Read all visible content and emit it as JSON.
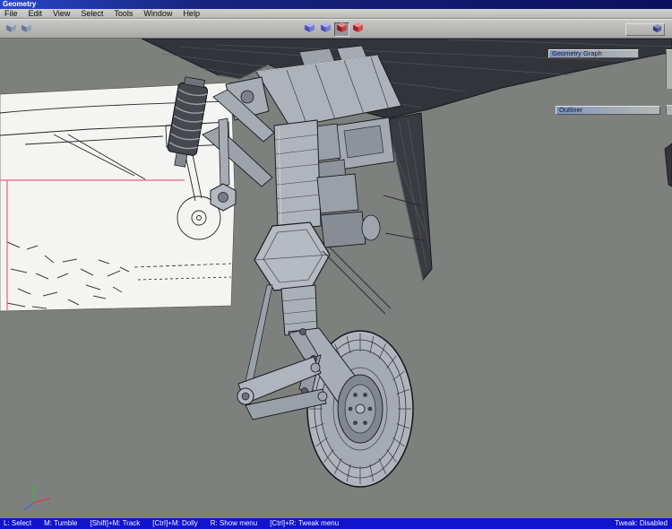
{
  "window": {
    "title": "Geometry"
  },
  "menubar": {
    "items": [
      "File",
      "Edit",
      "View",
      "Select",
      "Tools",
      "Window",
      "Help"
    ]
  },
  "toolbar": {
    "left_tools": [
      {
        "icon": "cube",
        "name": "shaded-cube-tool-1"
      },
      {
        "icon": "cube",
        "name": "shaded-cube-tool-2"
      }
    ],
    "center_tools": [
      {
        "icon": "cube",
        "color": "blue",
        "name": "display-mode-blue-1"
      },
      {
        "icon": "cube",
        "color": "blue",
        "name": "display-mode-blue-2"
      },
      {
        "icon": "cube",
        "color": "red",
        "name": "display-mode-red-1",
        "pressed": true
      },
      {
        "icon": "cube",
        "color": "red",
        "name": "display-mode-red-2"
      }
    ]
  },
  "panels": {
    "geometry_graph": {
      "title": "Geometry Graph"
    },
    "outliner": {
      "title": "Outliner"
    }
  },
  "statusbar": {
    "hints": [
      "L: Select",
      "M: Tumble",
      "[Shift]+M: Track",
      "[Ctrl]+M: Dolly",
      "R: Show menu",
      "[Ctrl]+R: Tweak menu"
    ],
    "tweak_state": "Tweak: Disabled"
  },
  "colors": {
    "titlebar_blue": "#18247e",
    "statusbar_blue": "#1113cd",
    "viewport_gray": "#7e807e",
    "fuselage_dark": "#33343a",
    "model_gray": "#b2b6be",
    "reference_white": "#f4f4f2",
    "reference_pink": "#e85f85",
    "icon_blue": "#6e7adc",
    "icon_red": "#d04850"
  }
}
